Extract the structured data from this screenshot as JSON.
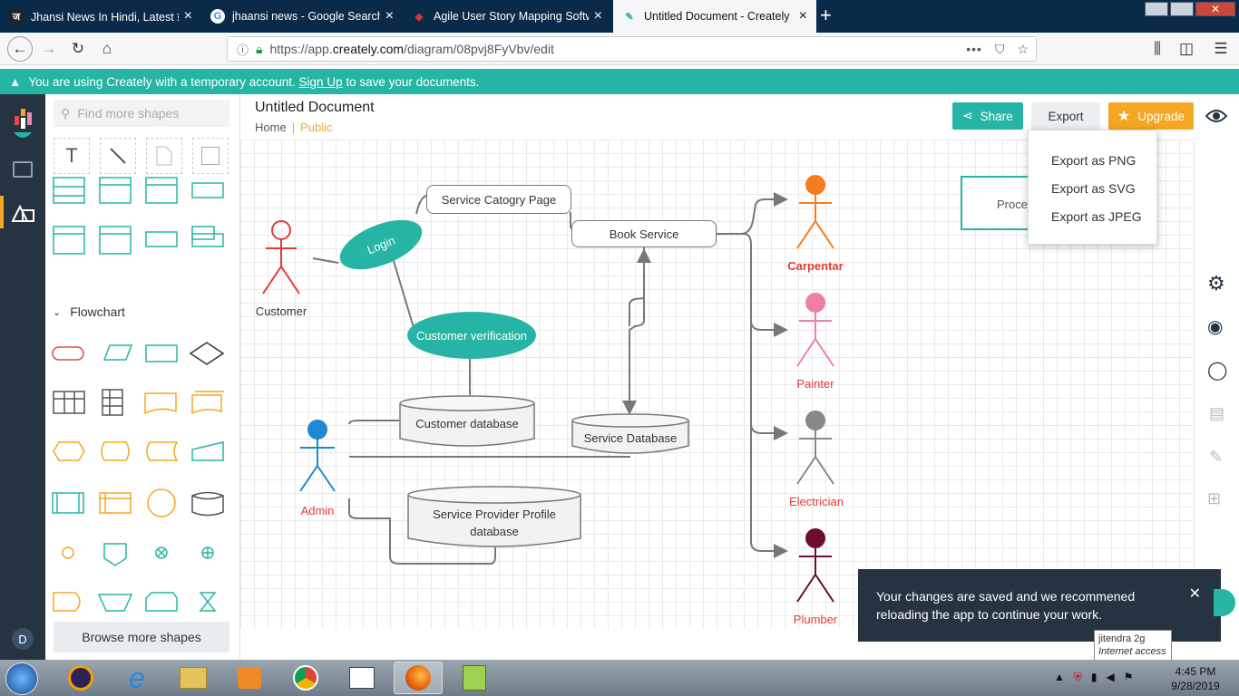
{
  "browser": {
    "tabs": [
      {
        "title": "Jhansi News In Hindi, Latest झां",
        "favicon": "ज"
      },
      {
        "title": "jhaansi news - Google Search",
        "favicon": "G"
      },
      {
        "title": "Agile User Story Mapping Softw",
        "favicon": "◆"
      },
      {
        "title": "Untitled Document - Creately",
        "favicon": "✎"
      }
    ],
    "url_prefix": "https://app.",
    "url_host": "creately.com",
    "url_path": "/diagram/08pvj8FyVbv/edit",
    "ellipsis": "•••"
  },
  "banner": {
    "text_before": "You are using Creately with a temporary account. ",
    "link": "Sign Up",
    "text_after": " to save your documents."
  },
  "rail": {
    "user_initial": "D"
  },
  "panel": {
    "search_placeholder": "Find more shapes",
    "section": "Flowchart",
    "browse_label": "Browse more shapes"
  },
  "header": {
    "title": "Untitled Document",
    "home": "Home",
    "visibility": "Public",
    "share": "Share",
    "export": "Export",
    "upgrade": "Upgrade"
  },
  "export_menu": [
    "Export as PNG",
    "Export as SVG",
    "Export as JPEG"
  ],
  "diagram": {
    "actors": {
      "customer": "Customer",
      "admin": "Admin",
      "carpentar": "Carpentar",
      "painter": "Painter",
      "electrician": "Electrician",
      "plumber": "Plumber"
    },
    "nodes": {
      "login": "Login",
      "customer_verification": "Customer verification",
      "service_category": "Service Catogry Page",
      "book_service": "Book Service",
      "customer_db": "Customer database",
      "service_db": "Service Database",
      "provider_db_1": "Service Provider Profile",
      "provider_db_2": "database",
      "process": "Proce"
    },
    "colors": {
      "teal": "#26b5a4",
      "customer": "#e53935",
      "admin": "#1e88d0",
      "carpentar": "#f57c1f",
      "painter": "#f07fa0",
      "electrician": "#888888",
      "plumber": "#6b0f2a"
    }
  },
  "toast": {
    "message": "Your changes are saved and we recommened reloading the app to continue your work."
  },
  "tooltip": {
    "line1": "jitendra 2g",
    "line2": "Internet access"
  },
  "taskbar": {
    "time": "4:45 PM",
    "date": "9/28/2019"
  }
}
